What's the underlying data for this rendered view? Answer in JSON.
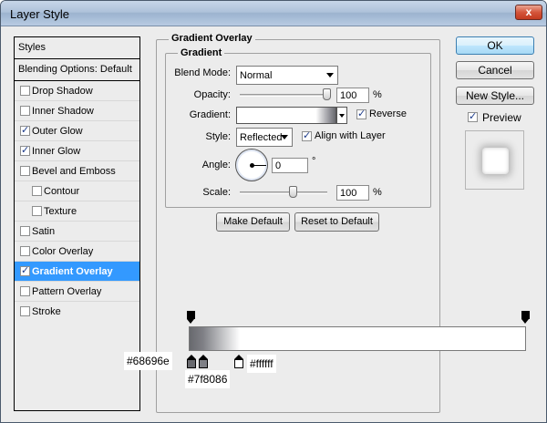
{
  "window": {
    "title": "Layer Style",
    "close_glyph": "x"
  },
  "styles_list": {
    "header": "Styles",
    "blending": "Blending Options: Default",
    "items": [
      {
        "label": "Drop Shadow",
        "checked": false
      },
      {
        "label": "Inner Shadow",
        "checked": false
      },
      {
        "label": "Outer Glow",
        "checked": true
      },
      {
        "label": "Inner Glow",
        "checked": true
      },
      {
        "label": "Bevel and Emboss",
        "checked": false
      },
      {
        "label": "Contour",
        "checked": false
      },
      {
        "label": "Texture",
        "checked": false
      },
      {
        "label": "Satin",
        "checked": false
      },
      {
        "label": "Color Overlay",
        "checked": false
      },
      {
        "label": "Gradient Overlay",
        "checked": true,
        "selected": true
      },
      {
        "label": "Pattern Overlay",
        "checked": false
      },
      {
        "label": "Stroke",
        "checked": false
      }
    ]
  },
  "panel": {
    "title": "Gradient Overlay",
    "subtitle": "Gradient",
    "blend_mode": {
      "label": "Blend Mode:",
      "value": "Normal"
    },
    "opacity": {
      "label": "Opacity:",
      "value": "100",
      "unit": "%",
      "level": 100
    },
    "gradient": {
      "label": "Gradient:",
      "reverse_label": "Reverse",
      "reverse_checked": true
    },
    "style": {
      "label": "Style:",
      "value": "Reflected",
      "align_label": "Align with Layer",
      "align_checked": true
    },
    "angle": {
      "label": "Angle:",
      "value": "0",
      "unit": "°"
    },
    "scale": {
      "label": "Scale:",
      "value": "100",
      "unit": "%",
      "level": 100
    },
    "make_default": "Make Default",
    "reset_default": "Reset to Default"
  },
  "buttons": {
    "ok": "OK",
    "cancel": "Cancel",
    "new_style": "New Style...",
    "preview_label": "Preview",
    "preview_checked": true
  },
  "gradient_editor": {
    "stops": [
      {
        "color": "#68696e",
        "label": "#68696e"
      },
      {
        "color": "#7f8086",
        "label": "#7f8086"
      },
      {
        "color": "#ffffff",
        "label": "#ffffff"
      }
    ]
  },
  "colors": {
    "selection": "#3399ff",
    "dialog_bg": "#ececec"
  }
}
